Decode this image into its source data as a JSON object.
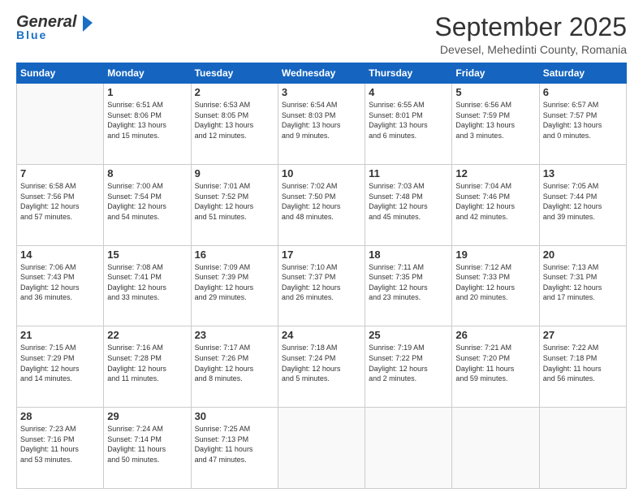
{
  "header": {
    "logo_general": "General",
    "logo_blue": "Blue",
    "month_title": "September 2025",
    "location": "Devesel, Mehedinti County, Romania"
  },
  "days_of_week": [
    "Sunday",
    "Monday",
    "Tuesday",
    "Wednesday",
    "Thursday",
    "Friday",
    "Saturday"
  ],
  "weeks": [
    [
      {
        "day": "",
        "info": ""
      },
      {
        "day": "1",
        "info": "Sunrise: 6:51 AM\nSunset: 8:06 PM\nDaylight: 13 hours\nand 15 minutes."
      },
      {
        "day": "2",
        "info": "Sunrise: 6:53 AM\nSunset: 8:05 PM\nDaylight: 13 hours\nand 12 minutes."
      },
      {
        "day": "3",
        "info": "Sunrise: 6:54 AM\nSunset: 8:03 PM\nDaylight: 13 hours\nand 9 minutes."
      },
      {
        "day": "4",
        "info": "Sunrise: 6:55 AM\nSunset: 8:01 PM\nDaylight: 13 hours\nand 6 minutes."
      },
      {
        "day": "5",
        "info": "Sunrise: 6:56 AM\nSunset: 7:59 PM\nDaylight: 13 hours\nand 3 minutes."
      },
      {
        "day": "6",
        "info": "Sunrise: 6:57 AM\nSunset: 7:57 PM\nDaylight: 13 hours\nand 0 minutes."
      }
    ],
    [
      {
        "day": "7",
        "info": "Sunrise: 6:58 AM\nSunset: 7:56 PM\nDaylight: 12 hours\nand 57 minutes."
      },
      {
        "day": "8",
        "info": "Sunrise: 7:00 AM\nSunset: 7:54 PM\nDaylight: 12 hours\nand 54 minutes."
      },
      {
        "day": "9",
        "info": "Sunrise: 7:01 AM\nSunset: 7:52 PM\nDaylight: 12 hours\nand 51 minutes."
      },
      {
        "day": "10",
        "info": "Sunrise: 7:02 AM\nSunset: 7:50 PM\nDaylight: 12 hours\nand 48 minutes."
      },
      {
        "day": "11",
        "info": "Sunrise: 7:03 AM\nSunset: 7:48 PM\nDaylight: 12 hours\nand 45 minutes."
      },
      {
        "day": "12",
        "info": "Sunrise: 7:04 AM\nSunset: 7:46 PM\nDaylight: 12 hours\nand 42 minutes."
      },
      {
        "day": "13",
        "info": "Sunrise: 7:05 AM\nSunset: 7:44 PM\nDaylight: 12 hours\nand 39 minutes."
      }
    ],
    [
      {
        "day": "14",
        "info": "Sunrise: 7:06 AM\nSunset: 7:43 PM\nDaylight: 12 hours\nand 36 minutes."
      },
      {
        "day": "15",
        "info": "Sunrise: 7:08 AM\nSunset: 7:41 PM\nDaylight: 12 hours\nand 33 minutes."
      },
      {
        "day": "16",
        "info": "Sunrise: 7:09 AM\nSunset: 7:39 PM\nDaylight: 12 hours\nand 29 minutes."
      },
      {
        "day": "17",
        "info": "Sunrise: 7:10 AM\nSunset: 7:37 PM\nDaylight: 12 hours\nand 26 minutes."
      },
      {
        "day": "18",
        "info": "Sunrise: 7:11 AM\nSunset: 7:35 PM\nDaylight: 12 hours\nand 23 minutes."
      },
      {
        "day": "19",
        "info": "Sunrise: 7:12 AM\nSunset: 7:33 PM\nDaylight: 12 hours\nand 20 minutes."
      },
      {
        "day": "20",
        "info": "Sunrise: 7:13 AM\nSunset: 7:31 PM\nDaylight: 12 hours\nand 17 minutes."
      }
    ],
    [
      {
        "day": "21",
        "info": "Sunrise: 7:15 AM\nSunset: 7:29 PM\nDaylight: 12 hours\nand 14 minutes."
      },
      {
        "day": "22",
        "info": "Sunrise: 7:16 AM\nSunset: 7:28 PM\nDaylight: 12 hours\nand 11 minutes."
      },
      {
        "day": "23",
        "info": "Sunrise: 7:17 AM\nSunset: 7:26 PM\nDaylight: 12 hours\nand 8 minutes."
      },
      {
        "day": "24",
        "info": "Sunrise: 7:18 AM\nSunset: 7:24 PM\nDaylight: 12 hours\nand 5 minutes."
      },
      {
        "day": "25",
        "info": "Sunrise: 7:19 AM\nSunset: 7:22 PM\nDaylight: 12 hours\nand 2 minutes."
      },
      {
        "day": "26",
        "info": "Sunrise: 7:21 AM\nSunset: 7:20 PM\nDaylight: 11 hours\nand 59 minutes."
      },
      {
        "day": "27",
        "info": "Sunrise: 7:22 AM\nSunset: 7:18 PM\nDaylight: 11 hours\nand 56 minutes."
      }
    ],
    [
      {
        "day": "28",
        "info": "Sunrise: 7:23 AM\nSunset: 7:16 PM\nDaylight: 11 hours\nand 53 minutes."
      },
      {
        "day": "29",
        "info": "Sunrise: 7:24 AM\nSunset: 7:14 PM\nDaylight: 11 hours\nand 50 minutes."
      },
      {
        "day": "30",
        "info": "Sunrise: 7:25 AM\nSunset: 7:13 PM\nDaylight: 11 hours\nand 47 minutes."
      },
      {
        "day": "",
        "info": ""
      },
      {
        "day": "",
        "info": ""
      },
      {
        "day": "",
        "info": ""
      },
      {
        "day": "",
        "info": ""
      }
    ]
  ]
}
